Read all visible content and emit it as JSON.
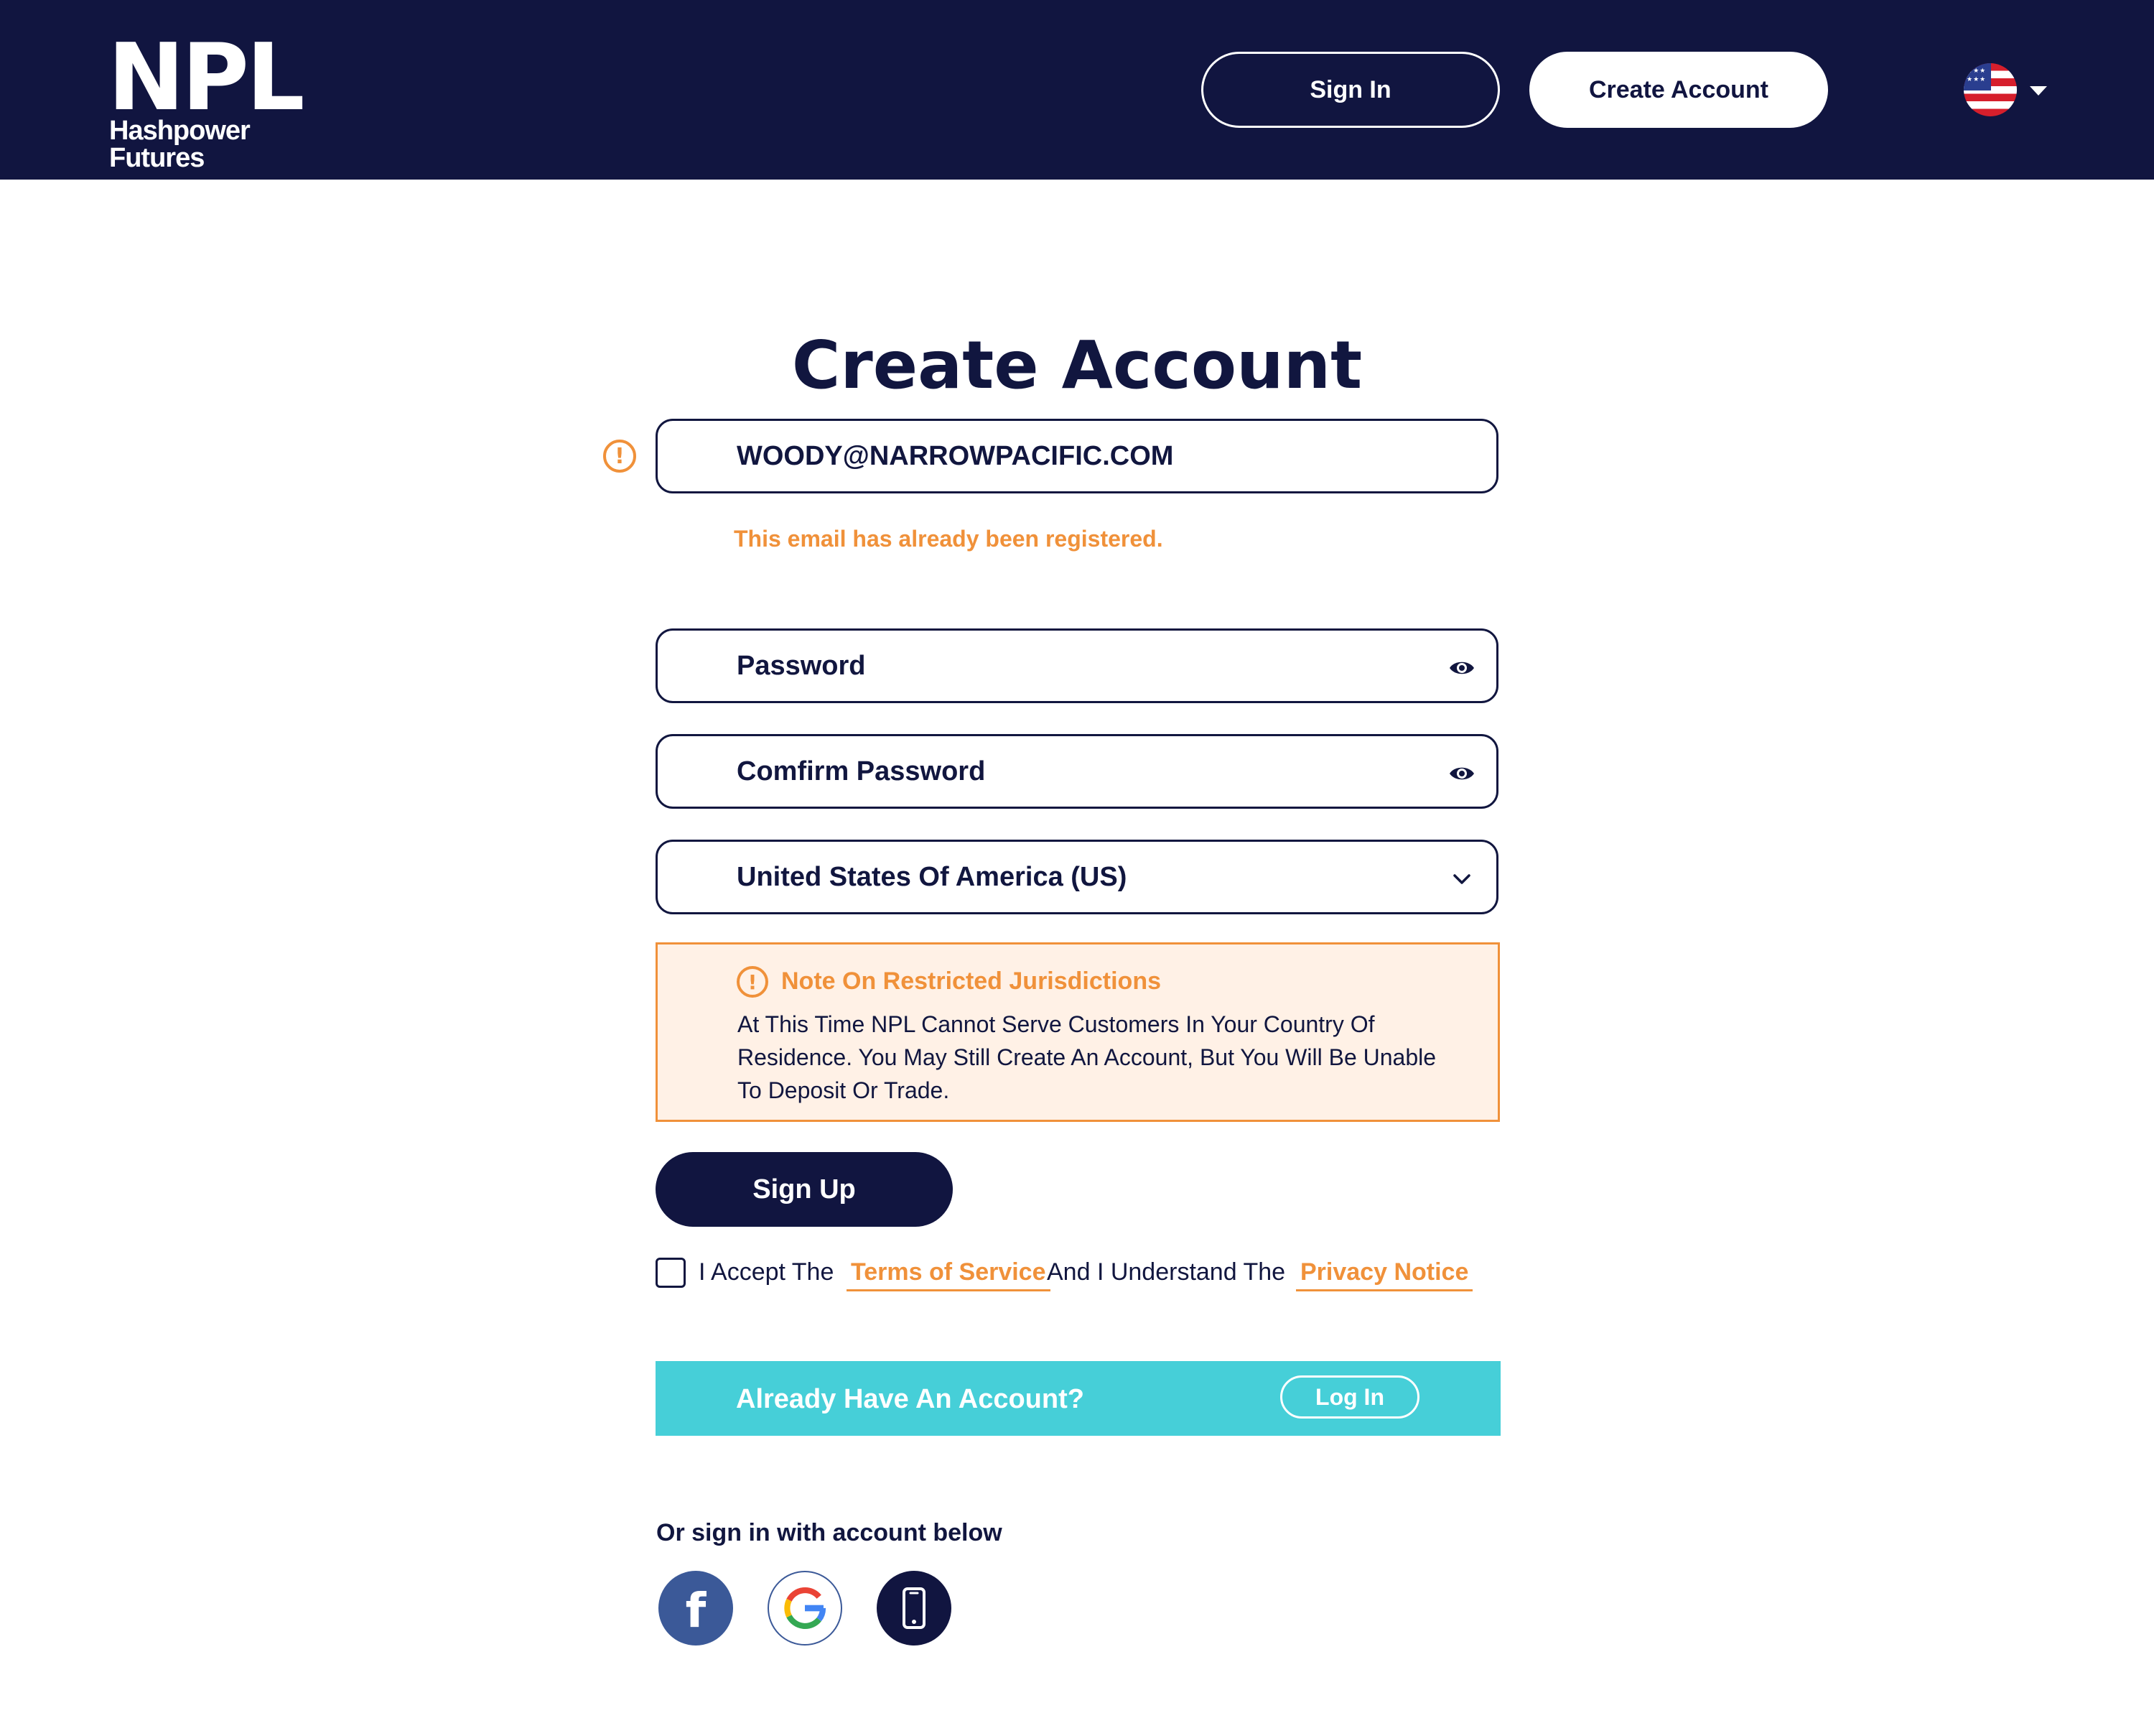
{
  "header": {
    "logo_mark": "NPL",
    "logo_sub": "Hashpower Futures",
    "sign_in_label": "Sign In",
    "create_account_label": "Create Account",
    "language_icon": "us-flag-icon"
  },
  "main": {
    "title": "Create Account",
    "email": {
      "value": "WOODY@NARROWPACIFIC.COM",
      "error": "This email has already been registered."
    },
    "password": {
      "placeholder": "Password"
    },
    "confirm_password": {
      "placeholder": "Comfirm Password"
    },
    "country": {
      "selected": "United States Of America (US)"
    },
    "note": {
      "title": "Note On Restricted Jurisdictions",
      "body": "At This Time NPL Cannot Serve Customers In Your Country Of Residence. You May Still Create An Account, But You Will Be Unable To Deposit Or Trade."
    },
    "sign_up_label": "Sign Up",
    "accept": {
      "prefix": "I Accept The",
      "terms_link": "Terms of Service",
      "middle": "And I Understand The",
      "privacy_link": "Privacy Notice",
      "checked": false
    },
    "login_bar": {
      "text": "Already Have An Account?",
      "button": "Log In"
    },
    "social": {
      "label": "Or sign in with account below",
      "providers": [
        "facebook-icon",
        "google-icon",
        "phone-icon"
      ]
    }
  },
  "colors": {
    "navy": "#111540",
    "accent_orange": "#f0913a",
    "note_bg": "#fff1e6",
    "teal": "#46cfd8",
    "facebook": "#3b5998"
  }
}
